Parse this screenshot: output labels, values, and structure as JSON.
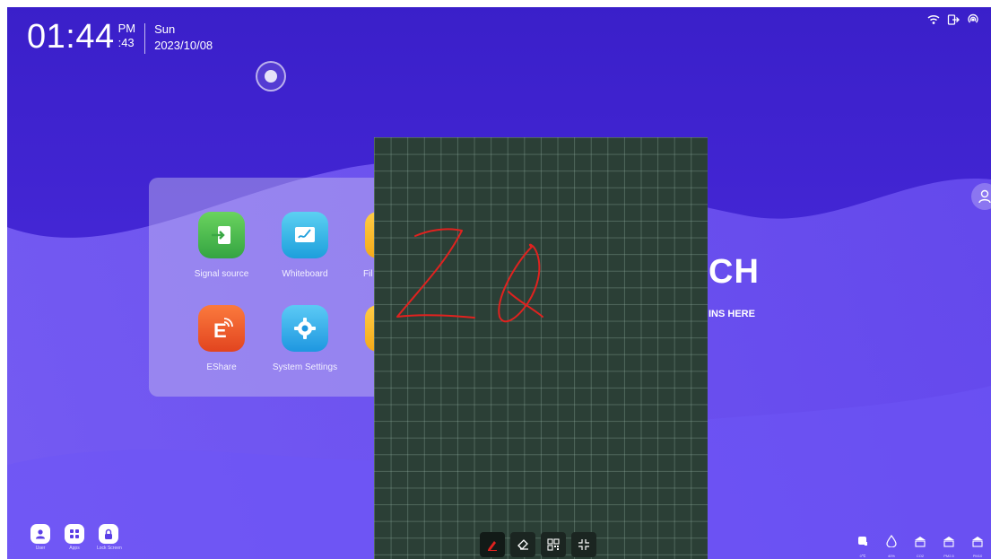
{
  "status_bar": {
    "time": "01:44",
    "ampm": "PM",
    "seconds": ":43",
    "weekday": "Sun",
    "date": "2023/10/08",
    "icons": [
      "wifi-icon",
      "exit-icon",
      "hotspot-icon"
    ]
  },
  "apps": [
    {
      "label": "Signal source",
      "icon": "signal-source-icon",
      "color": "#43b74a"
    },
    {
      "label": "Whiteboard",
      "icon": "whiteboard-icon",
      "color": "#2ab3e6"
    },
    {
      "label": "Fil",
      "icon": "files-icon",
      "color": "#f6b623"
    },
    {
      "label": "EShare",
      "icon": "eshare-icon",
      "color": "#ef5a2a"
    },
    {
      "label": "System Settings",
      "icon": "settings-icon",
      "color": "#2aa7ea"
    },
    {
      "label": "",
      "icon": "app-icon",
      "color": "#f6b623"
    }
  ],
  "welcome": {
    "title_fragment": "CH",
    "subtitle_fragment": "INS HERE"
  },
  "whiteboard": {
    "ink_text": "ZQ",
    "ink_color": "#e0221f",
    "board_color": "#2b3f36",
    "toolbar": [
      "pen-icon",
      "eraser-icon",
      "qr-code-icon",
      "exit-fullscreen-icon"
    ]
  },
  "dock": [
    {
      "label": "User",
      "icon": "user-icon"
    },
    {
      "label": "Apps",
      "icon": "apps-grid-icon"
    },
    {
      "label": "Lock Screen",
      "icon": "lock-icon"
    }
  ],
  "tray": [
    {
      "label": "0℃",
      "icon": "temperature-icon",
      "level": null
    },
    {
      "label": "40%",
      "icon": "humidity-icon",
      "level": null
    },
    {
      "label": "CO2",
      "icon": "co2-icon",
      "level": 0.3
    },
    {
      "label": "PM2.5",
      "icon": "pm25-icon",
      "level": 0.3
    },
    {
      "label": "PM10",
      "icon": "pm10-icon",
      "level": 0.3
    }
  ]
}
